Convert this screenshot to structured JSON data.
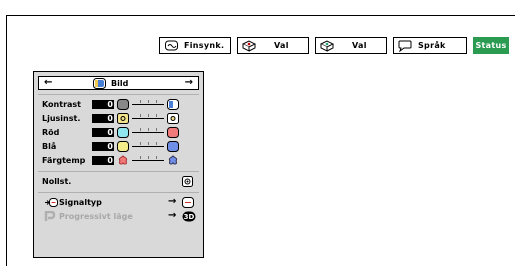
{
  "tabs": [
    {
      "label": "Finsynk.",
      "icon": "fine-sync-icon"
    },
    {
      "label": "Val",
      "icon": "options1-icon"
    },
    {
      "label": "Val",
      "icon": "options2-icon"
    },
    {
      "label": "Språk",
      "icon": "language-speech-icon"
    },
    {
      "label": "Status",
      "icon": ""
    }
  ],
  "active_tab": "Status",
  "colors": {
    "status_green": "#2c9b52",
    "panel_gray": "#d9d9d9"
  },
  "menu": {
    "title": "Bild",
    "adjustments": [
      {
        "label": "Kontrast",
        "value": "0",
        "icon_left": "contrast-low-icon",
        "icon_right": "contrast-high-icon"
      },
      {
        "label": "Ljusinst.",
        "value": "0",
        "icon_left": "brightness-low-icon",
        "icon_right": "brightness-high-icon"
      },
      {
        "label": "Röd",
        "value": "0",
        "icon_left": "red-low-icon",
        "icon_right": "red-high-icon"
      },
      {
        "label": "Blå",
        "value": "0",
        "icon_left": "blue-low-icon",
        "icon_right": "blue-high-icon"
      },
      {
        "label": "Färgtemp",
        "value": "0",
        "icon_left": "color-temp-low-icon",
        "icon_right": "color-temp-high-icon"
      }
    ],
    "reset_label": "Nollst.",
    "signal_type_label": "Signaltyp",
    "progressive_label": "Progressivt läge",
    "progressive_badge": "3D"
  }
}
